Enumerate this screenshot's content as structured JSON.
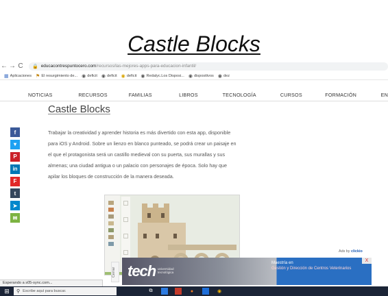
{
  "slide": {
    "title": "Castle Blocks"
  },
  "browser": {
    "nav": {
      "back": "←",
      "forward": "→",
      "reload": "C"
    },
    "url_host": "educacontrespuntocero.com",
    "url_path": "/recursos/las-mejores-apps-para-educacion-infantil/",
    "bookmarks": [
      {
        "icon": "apps-icon",
        "label": "Aplicaciones"
      },
      {
        "icon": "flag-icon",
        "label": "El resurgimiento de..."
      },
      {
        "icon": "globe-icon",
        "label": "deficit"
      },
      {
        "icon": "globe-icon",
        "label": "deficit"
      },
      {
        "icon": "globe-icon",
        "label": "deficit"
      },
      {
        "icon": "globe-icon",
        "label": "Redalyc.Los Disposi..."
      },
      {
        "icon": "globe-icon",
        "label": "dispositivos"
      },
      {
        "icon": "globe-icon",
        "label": "dez"
      }
    ]
  },
  "site_nav": [
    "NOTICIAS",
    "RECURSOS",
    "FAMILIAS",
    "LIBROS",
    "TECNOLOGÍA",
    "CURSOS",
    "FORMACIÓN",
    "EN"
  ],
  "article": {
    "title": "Castle Blocks",
    "lines": [
      "Trabajar la creatividad y aprender historia es más divertido con esta app, disponible",
      "para iOS y Android. Sobre un lienzo en blanco punteado, se podrá crear un paisaje en",
      "el que el protagonista será un castillo medieval con su puerta, sus murallas y sus",
      "almenas; una ciudad antigua o un palacio con personajes de época. Solo hay que",
      "apilar los bloques de construcción de la manera deseada."
    ]
  },
  "social": [
    {
      "name": "facebook-icon",
      "glyph": "f",
      "color": "#3b5998"
    },
    {
      "name": "twitter-icon",
      "glyph": "▾",
      "color": "#1da1f2"
    },
    {
      "name": "pinterest-icon",
      "glyph": "P",
      "color": "#cb2027"
    },
    {
      "name": "linkedin-icon",
      "glyph": "in",
      "color": "#0077b5"
    },
    {
      "name": "flipboard-icon",
      "glyph": "F",
      "color": "#e12828"
    },
    {
      "name": "tumblr-icon",
      "glyph": "t",
      "color": "#35465c"
    },
    {
      "name": "telegram-icon",
      "glyph": "➤",
      "color": "#0088cc"
    },
    {
      "name": "email-icon",
      "glyph": "✉",
      "color": "#7cb342"
    }
  ],
  "ads": {
    "ads_by_prefix": "Ads by",
    "ads_by_brand": "clickio",
    "close": "X",
    "logo": "tech",
    "logo_sub": "universidad tecnológica",
    "headline": "Maestría en",
    "text": "Gestión y Dirección de Centros Veterinarios",
    "side_label": "Cerrar"
  },
  "status_text": "Esperando a s05-sync.com...",
  "taskbar": {
    "search_placeholder": "Escribe aquí para buscar."
  }
}
